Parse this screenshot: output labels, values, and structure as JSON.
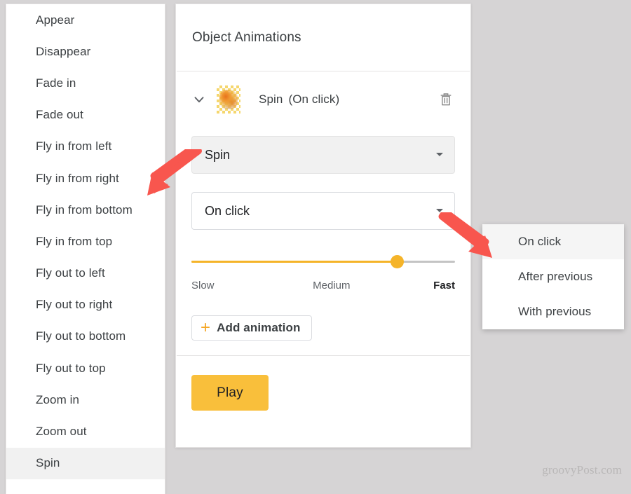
{
  "animation_type_menu": {
    "items": [
      {
        "label": "Appear",
        "selected": false
      },
      {
        "label": "Disappear",
        "selected": false
      },
      {
        "label": "Fade in",
        "selected": false
      },
      {
        "label": "Fade out",
        "selected": false
      },
      {
        "label": "Fly in from left",
        "selected": false
      },
      {
        "label": "Fly in from right",
        "selected": false
      },
      {
        "label": "Fly in from bottom",
        "selected": false
      },
      {
        "label": "Fly in from top",
        "selected": false
      },
      {
        "label": "Fly out to left",
        "selected": false
      },
      {
        "label": "Fly out to right",
        "selected": false
      },
      {
        "label": "Fly out to bottom",
        "selected": false
      },
      {
        "label": "Fly out to top",
        "selected": false
      },
      {
        "label": "Zoom in",
        "selected": false
      },
      {
        "label": "Zoom out",
        "selected": false
      },
      {
        "label": "Spin",
        "selected": true
      }
    ]
  },
  "panel": {
    "title": "Object Animations",
    "animation_row": {
      "chevron_icon": "chevron-down-icon",
      "thumbnail_icon": "slide-object-thumbnail",
      "effect_name": "Spin",
      "trigger_name": "(On click)",
      "delete_icon": "trash-icon"
    },
    "effect_select": {
      "value": "Spin",
      "caret_icon": "caret-down-icon",
      "hovered": true
    },
    "trigger_select": {
      "value": "On click",
      "caret_icon": "caret-down-icon",
      "hovered": false
    },
    "speed_slider": {
      "value_percent": 78,
      "label_slow": "Slow",
      "label_medium": "Medium",
      "label_fast": "Fast",
      "track_color": "#f5b429"
    },
    "add_animation": {
      "plus_icon": "plus-icon",
      "label": "Add animation"
    },
    "play": {
      "label": "Play",
      "color": "#f9bf3b"
    }
  },
  "trigger_dropdown": {
    "items": [
      {
        "label": "On click",
        "selected": true
      },
      {
        "label": "After previous",
        "selected": false
      },
      {
        "label": "With previous",
        "selected": false
      }
    ]
  },
  "annotations": {
    "arrow_color": "#f8564e",
    "arrow_to_effect_select": "arrow-pointing-to-effect-select",
    "arrow_to_trigger_menu": "arrow-pointing-to-trigger-dropdown"
  },
  "watermark": {
    "text": "groovyPost.com"
  }
}
